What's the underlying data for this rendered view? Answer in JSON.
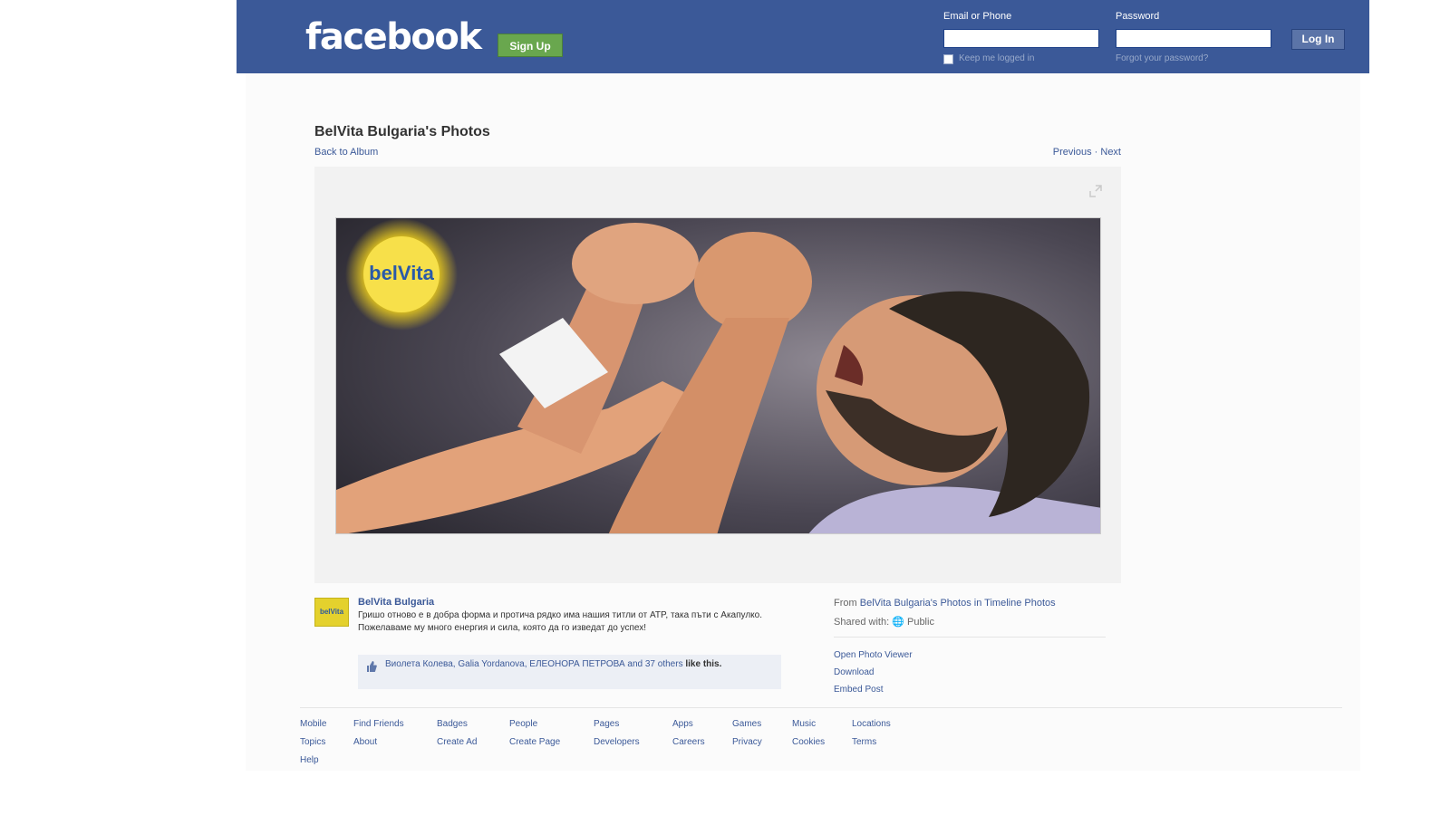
{
  "header": {
    "logo": "facebook",
    "signup_label": "Sign Up",
    "email_label": "Email or Phone",
    "password_label": "Password",
    "login_label": "Log In",
    "keep_logged_in": "Keep me logged in",
    "forgot_password": "Forgot your password?"
  },
  "album": {
    "title": "BelVita Bulgaria's Photos",
    "back_link": "Back to Album",
    "prev_next": "Previous · Next"
  },
  "photo": {
    "logo_text": "belVita"
  },
  "post": {
    "avatar_text": "belVita",
    "poster": "BelVita Bulgaria",
    "caption": "Гришо отново е в добра форма и протича рядко има нашия титли от ATP, така пъти с Акапулко. Пожелаваме му много енергия и сила, която да го изведат до успех!",
    "likes_names": "Виолета Колева, Galia Yordanova, ЕЛЕОНОРА ПЕТРОВА and 37 others",
    "likes_suffix": "like this."
  },
  "side": {
    "from_label": "From",
    "from_link": "BelVita Bulgaria's Photos in Timeline Photos",
    "shared_label": "Shared with:",
    "shared_value": "Public",
    "open_viewer": "Open Photo Viewer",
    "download": "Download",
    "embed": "Embed Post"
  },
  "footer": {
    "row1": [
      "Mobile",
      "Find Friends",
      "Badges",
      "People",
      "Pages",
      "Apps",
      "Games",
      "Music",
      "Locations"
    ],
    "row2": [
      "Topics",
      "About",
      "Create Ad",
      "Create Page",
      "Developers",
      "Careers",
      "Privacy",
      "Cookies",
      "Terms"
    ],
    "row3": [
      "Help"
    ]
  },
  "colors": {
    "brand": "#3b5998",
    "signup_green": "#69a74e",
    "background": "#ffffff"
  }
}
